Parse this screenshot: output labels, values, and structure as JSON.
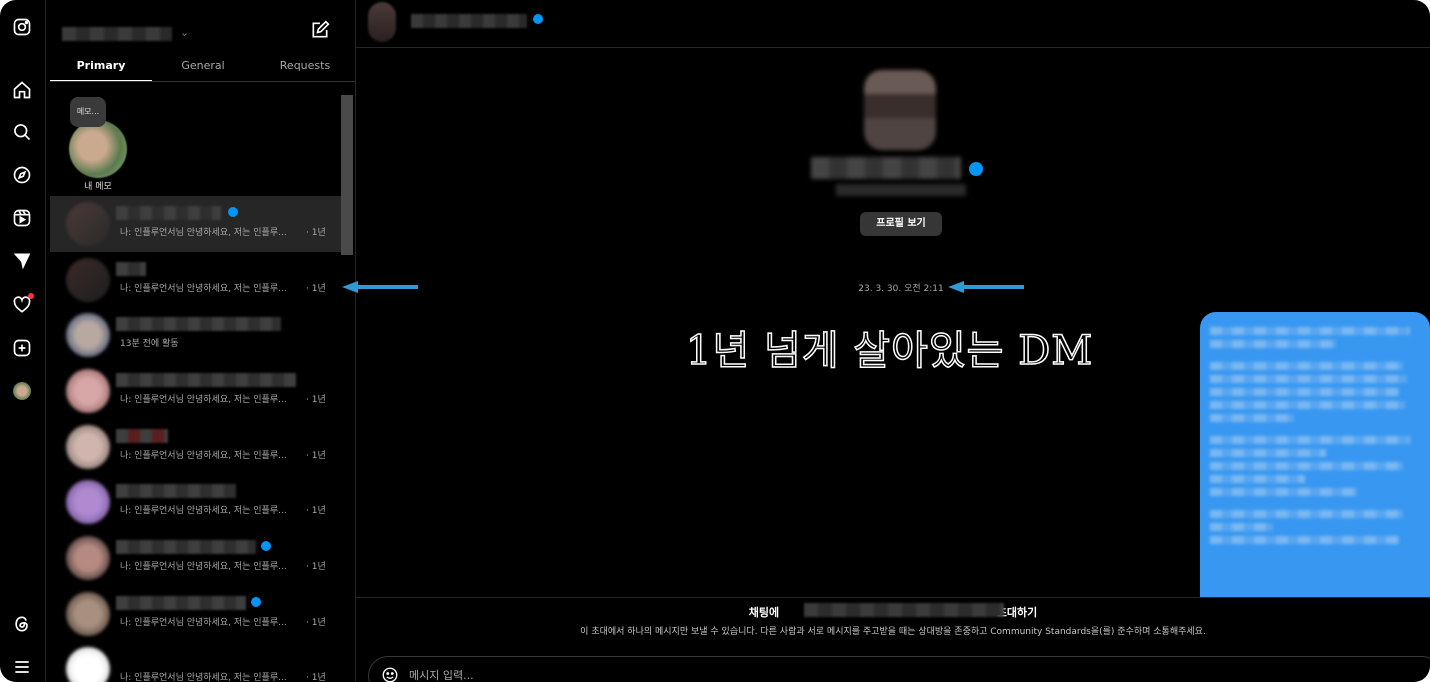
{
  "window": {
    "accent_blue": "#0095f6",
    "bubble_blue": "#3897f0",
    "annotation_arrow": "#2e9ad6"
  },
  "rail": {
    "icons": [
      "instagram-logo-icon",
      "home-icon",
      "search-icon",
      "explore-icon",
      "reels-icon",
      "messages-icon",
      "notifications-heart-icon",
      "create-icon",
      "profile-avatar-icon",
      "threads-icon",
      "menu-icon"
    ]
  },
  "threads": {
    "tabs": [
      {
        "label": "Primary",
        "active": true
      },
      {
        "label": "General",
        "active": false
      },
      {
        "label": "Requests",
        "active": false
      }
    ],
    "note": {
      "bubble_text": "메모...",
      "label": "내 메모"
    },
    "rows": [
      {
        "preview": "나: 인플루언서님 안녕하세요, 저는 인플루...",
        "time": "· 1년",
        "selected": true
      },
      {
        "preview": "나: 인플루언서님 안녕하세요, 저는 인플루...",
        "time": "· 1년",
        "selected": false
      },
      {
        "preview": "13분 전에 활동",
        "time": "",
        "selected": false
      },
      {
        "preview": "나: 인플루언서님 안녕하세요, 저는 인플루...",
        "time": "· 1년",
        "selected": false
      },
      {
        "preview": "나: 인플루언서님 안녕하세요, 저는 인플루...",
        "time": "· 1년",
        "selected": false
      },
      {
        "preview": "나: 인플루언서님 안녕하세요, 저는 인플루...",
        "time": "· 1년",
        "selected": false
      },
      {
        "preview": "나: 인플루언서님 안녕하세요, 저는 인플루...",
        "time": "· 1년",
        "selected": false
      },
      {
        "preview": "나: 인플루언서님 안녕하세요, 저는 인플루...",
        "time": "· 1년",
        "selected": false
      },
      {
        "preview": "나: 인플루언서님 안녕하세요, 저는 인플루...",
        "time": "· 1년",
        "selected": false
      }
    ]
  },
  "chat": {
    "view_profile_label": "프로필 보기",
    "timestamp": "23. 3. 30. 오전 2:11",
    "overlay_caption": "1년 넘게 살아있는 DM",
    "invite": {
      "title_prefix": "채팅에",
      "title_suffix": "초대하기",
      "description": "이 초대에서 하나의 메시지만 보낼 수 있습니다. 다른 사람과 서로 메시지를 주고받을 때는 상대방을 존중하고 Community Standards을(를) 준수하며 소통해주세요."
    },
    "message_input": {
      "placeholder": "메시지 입력..."
    }
  }
}
